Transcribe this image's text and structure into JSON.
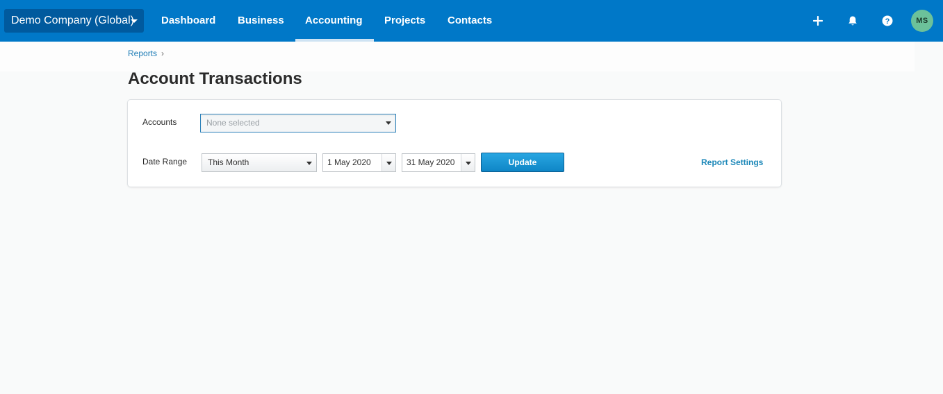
{
  "org": {
    "name": "Demo Company (Global)"
  },
  "nav": {
    "items": [
      {
        "label": "Dashboard"
      },
      {
        "label": "Business"
      },
      {
        "label": "Accounting",
        "active": true
      },
      {
        "label": "Projects"
      },
      {
        "label": "Contacts"
      }
    ]
  },
  "top_icons": [
    "plus-icon",
    "bell-icon",
    "help-icon"
  ],
  "user": {
    "initials": "MS",
    "avatar_color": "#6cc19a"
  },
  "breadcrumb": {
    "reports": "Reports",
    "separator": "›"
  },
  "page": {
    "title": "Account Transactions"
  },
  "form": {
    "accounts_label": "Accounts",
    "accounts_placeholder": "None selected",
    "date_range_label": "Date Range",
    "date_range_value": "This Month",
    "from_date": "1 May 2020",
    "to_date": "31 May 2020",
    "update_label": "Update",
    "report_settings_label": "Report Settings"
  },
  "colors": {
    "topbar": "#0078c8",
    "accent": "#1b87b8",
    "button": "#1595d6"
  }
}
